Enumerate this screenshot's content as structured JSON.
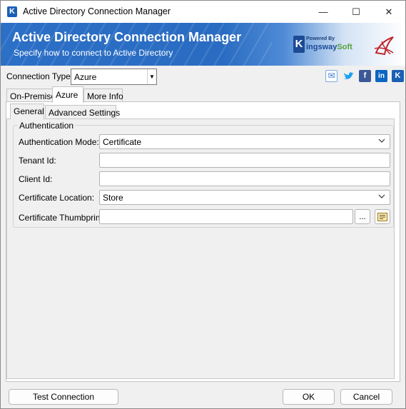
{
  "window": {
    "title": "Active Directory Connection Manager",
    "minimize": "—",
    "maximize": "☐",
    "close": "✕"
  },
  "banner": {
    "title": "Active Directory Connection Manager",
    "subtitle": "Specify how to connect to Active Directory",
    "logo_powered": "Powered By",
    "logo_k": "K",
    "logo_name_a": "ingsway",
    "logo_name_b": "Soft"
  },
  "connection": {
    "label": "Connection Type:",
    "value": "Azure",
    "arrow": "▼"
  },
  "social": {
    "mail": "✉",
    "twitter": "🐦",
    "facebook": "f",
    "linkedin": "in",
    "kingsway": "K"
  },
  "tabs": [
    "On-Premise",
    "Azure",
    "More Info"
  ],
  "subtabs": [
    "General",
    "Advanced Settings"
  ],
  "auth": {
    "group_label": "Authentication",
    "mode_label": "Authentication Mode:",
    "mode_value": "Certificate",
    "tenant_label": "Tenant Id:",
    "tenant_value": "",
    "client_label": "Client Id:",
    "client_value": "",
    "location_label": "Certificate Location:",
    "location_value": "Store",
    "thumb_label": "Certificate Thumbprint:",
    "thumb_value": "",
    "browse": "...",
    "chevron": "⌄"
  },
  "buttons": {
    "test": "Test Connection",
    "ok": "OK",
    "cancel": "Cancel"
  },
  "colors": {
    "banner_blue": "#2b6fc6",
    "brand_dark": "#1d4a94",
    "brand_green": "#5aa03a",
    "facebook": "#3b5998",
    "linkedin": "#0a66c2",
    "twitter": "#1da1f2"
  }
}
